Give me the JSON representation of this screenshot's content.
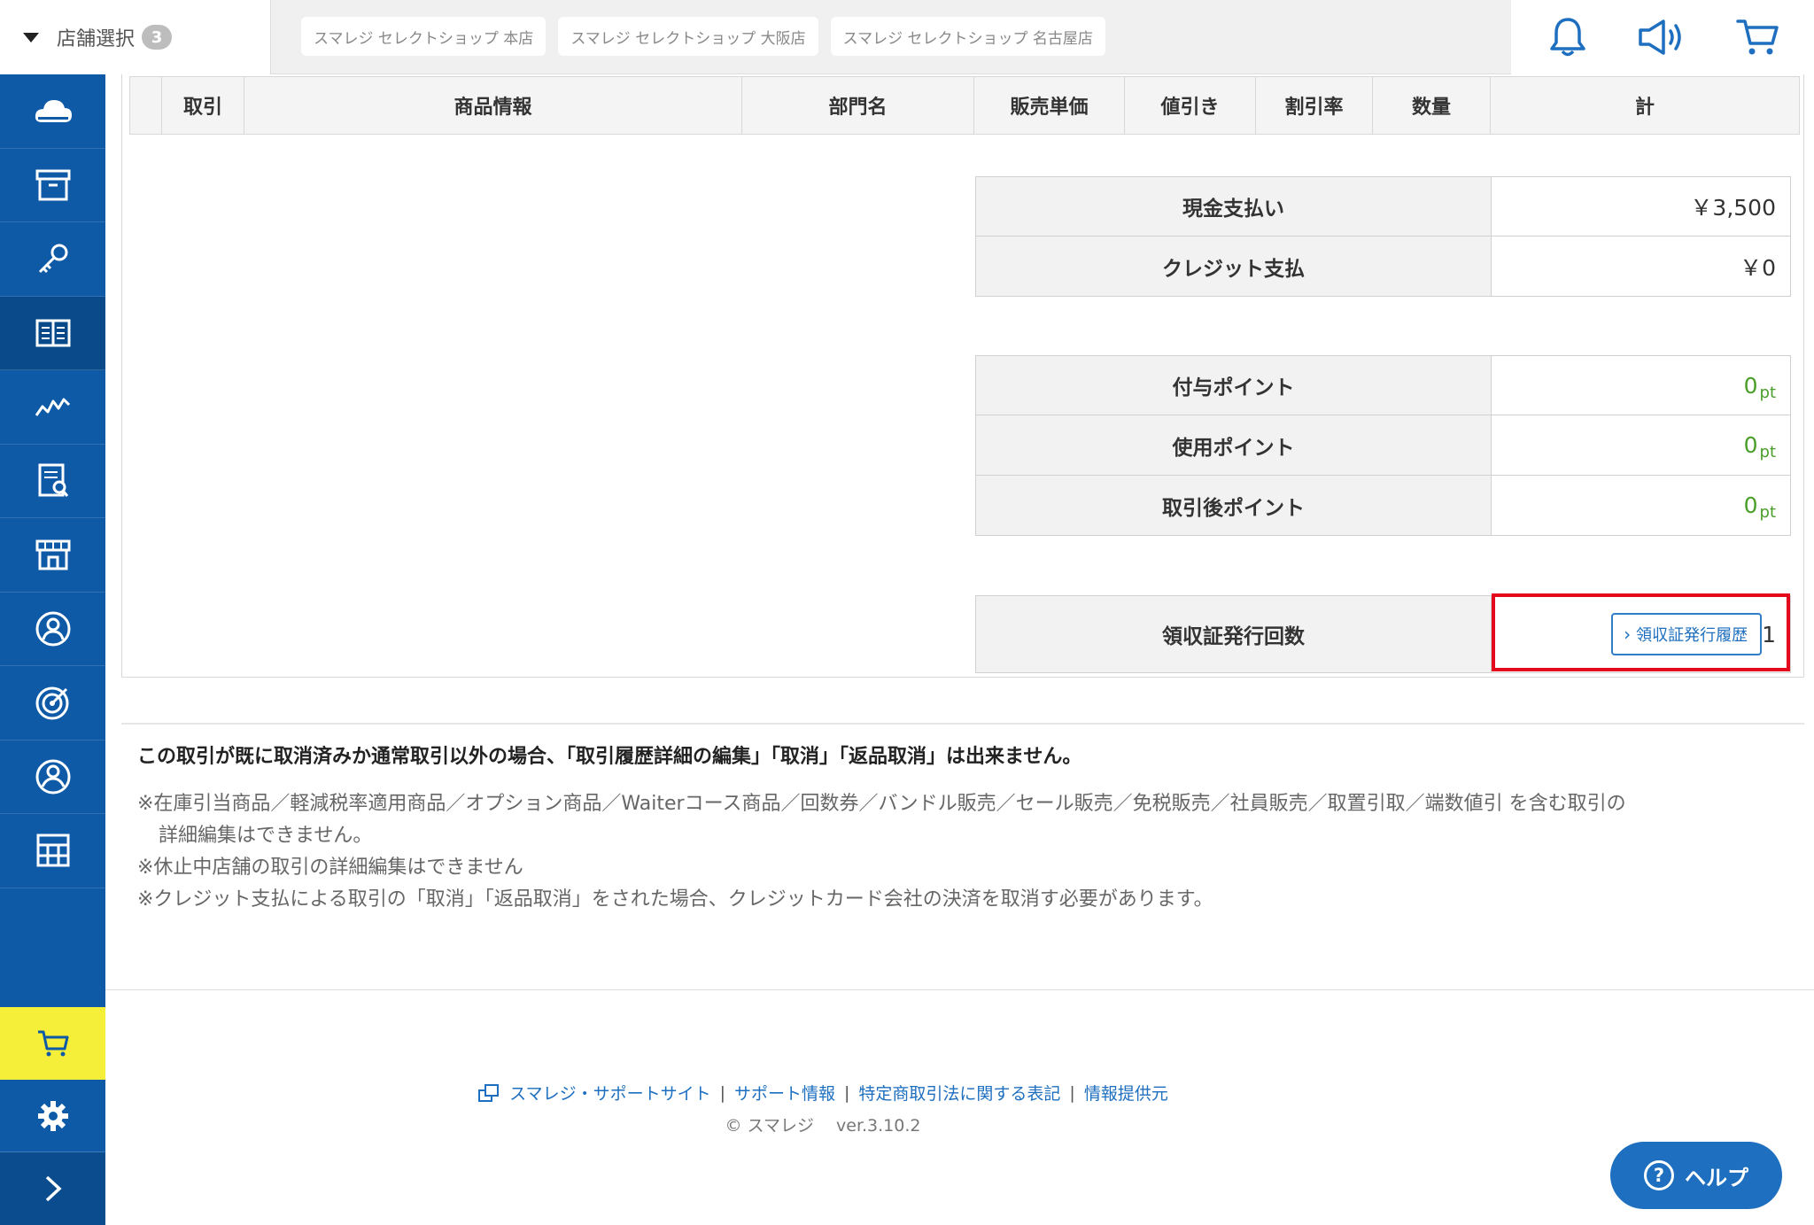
{
  "topbar": {
    "store_select_label": "店舗選択",
    "store_count": "3",
    "stores": [
      "スマレジ セレクトショップ 本店",
      "スマレジ セレクトショップ 大阪店",
      "スマレジ セレクトショップ 名古屋店"
    ],
    "icons": [
      "bell-icon",
      "megaphone-icon",
      "cart-icon"
    ]
  },
  "sidebar": {
    "items": [
      {
        "icon": "cloud-icon"
      },
      {
        "icon": "archive-box-icon"
      },
      {
        "icon": "key-icon"
      },
      {
        "icon": "book-icon",
        "active": true
      },
      {
        "icon": "trend-chart-icon"
      },
      {
        "icon": "report-document-icon"
      },
      {
        "icon": "store-icon"
      },
      {
        "icon": "customer-icon"
      },
      {
        "icon": "target-icon"
      },
      {
        "icon": "staff-icon"
      },
      {
        "icon": "grid-icon"
      }
    ],
    "bottom": [
      "cart-icon",
      "gear-icon",
      "chevron-right-icon"
    ],
    "colors": {
      "sidebar": "#0e5aa7",
      "cart_highlight": "#f6ef3a"
    }
  },
  "table": {
    "headers": [
      "",
      "取引",
      "商品情報",
      "部門名",
      "販売単価",
      "値引き",
      "割引率",
      "数量",
      "計"
    ]
  },
  "payments": [
    {
      "label": "現金支払い",
      "value": "￥3,500"
    },
    {
      "label": "クレジット支払",
      "value": "￥0"
    }
  ],
  "points": [
    {
      "label": "付与ポイント",
      "value": "0",
      "unit": "pt"
    },
    {
      "label": "使用ポイント",
      "value": "0",
      "unit": "pt"
    },
    {
      "label": "取引後ポイント",
      "value": "0",
      "unit": "pt"
    }
  ],
  "receipt": {
    "label": "領収証発行回数",
    "button": "領収証発行履歴",
    "count": "1"
  },
  "notice": "この取引が既に取消済みか通常取引以外の場合、「取引履歴詳細の編集」「取消」「返品取消」は出来ません。",
  "notes": {
    "line1": "※在庫引当商品／軽減税率適用商品／オプション商品／Waiterコース商品／回数券／バンドル販売／セール販売／免税販売／社員販売／取置引取／端数値引 を含む取引の",
    "line1_cont": "詳細編集はできません。",
    "line2": "※休止中店舗の取引の詳細編集はできません",
    "line3": "※クレジット支払による取引の「取消」「返品取消」をされた場合、クレジットカード会社の決済を取消す必要があります。"
  },
  "footer": {
    "links": [
      "スマレジ・サポートサイト",
      "サポート情報",
      "特定商取引法に関する表記",
      "情報提供元"
    ],
    "separator": "|",
    "copyright": "© スマレジ　 ver.3.10.2"
  },
  "help": {
    "label": "ヘルプ"
  },
  "colors": {
    "accent": "#1e6fbf",
    "highlight_border": "#e4081c",
    "points_green": "#4a9e2a"
  }
}
